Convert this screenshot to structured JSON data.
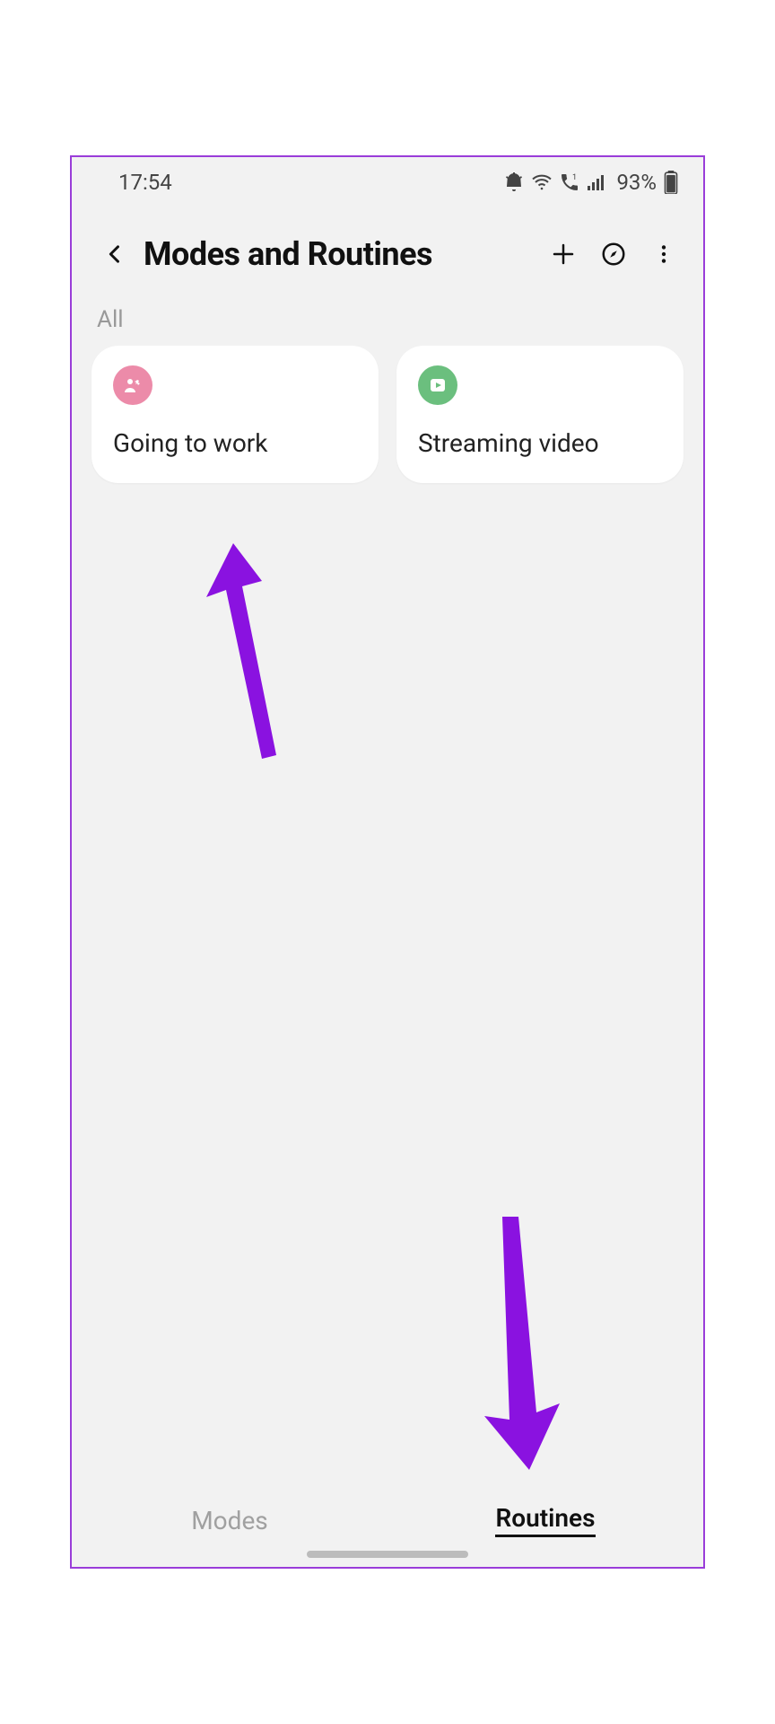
{
  "status": {
    "time": "17:54",
    "battery_percent": "93%"
  },
  "header": {
    "title": "Modes and Routines"
  },
  "section": {
    "label": "All"
  },
  "routines": [
    {
      "title": "Going to work"
    },
    {
      "title": "Streaming video"
    }
  ],
  "tabs": {
    "modes": "Modes",
    "routines": "Routines"
  }
}
